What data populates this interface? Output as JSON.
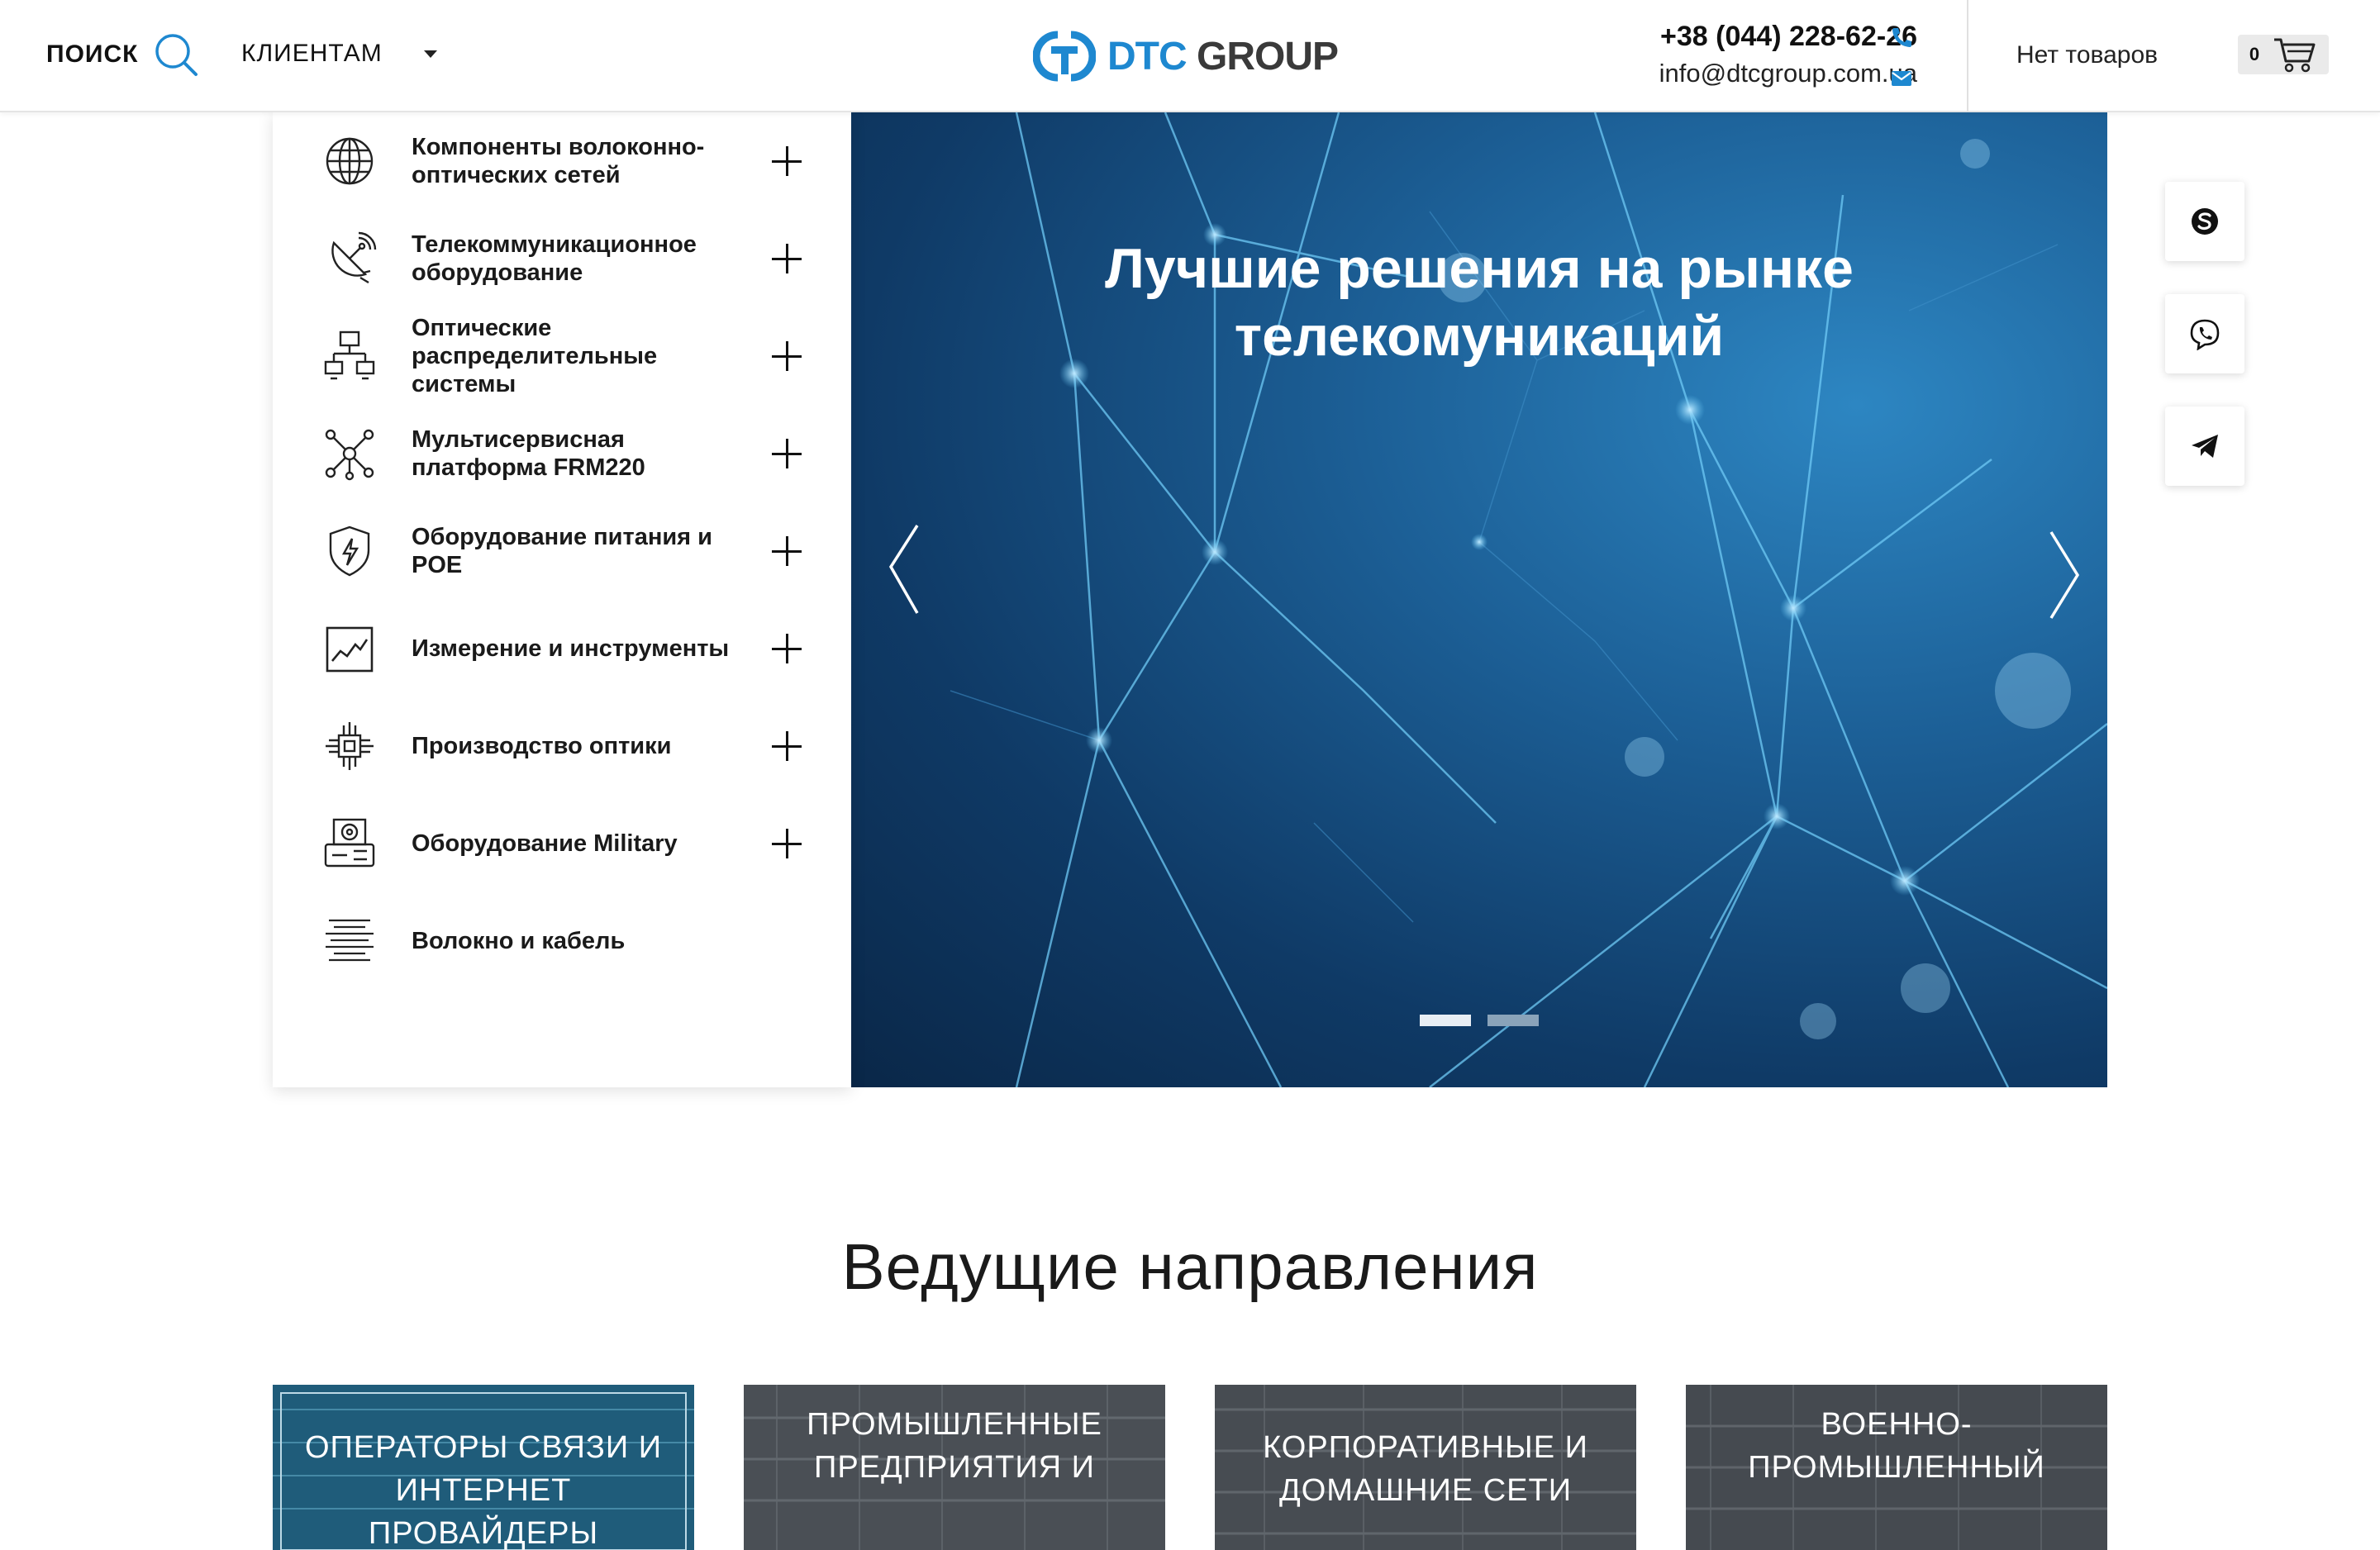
{
  "header": {
    "search_label": "ПОИСК",
    "clients_label": "КЛИЕНТАМ",
    "logo_dtc": "DTC",
    "logo_group": "GROUP",
    "phone": "+38 (044) 228-62-26",
    "email": "info@dtcgroup.com.ua",
    "cart_text": "Нет товаров",
    "cart_count": "0"
  },
  "sidebar": {
    "items": [
      {
        "label": "Компоненты волоконно-оптических сетей",
        "icon": "globe-icon"
      },
      {
        "label": "Телекоммуникационное оборудование",
        "icon": "satellite-dish-icon"
      },
      {
        "label": "Оптические распределительные системы",
        "icon": "network-monitors-icon"
      },
      {
        "label": "Мультисервисная платформа FRM220",
        "icon": "hub-nodes-icon"
      },
      {
        "label": "Оборудование питания и POE",
        "icon": "shield-bolt-icon"
      },
      {
        "label": "Измерение и инструменты",
        "icon": "chart-line-icon"
      },
      {
        "label": "Производство оптики",
        "icon": "chip-icon"
      },
      {
        "label": "Оборудование Military",
        "icon": "radio-device-icon"
      },
      {
        "label": "Волокно и кабель",
        "icon": "cable-lines-icon"
      }
    ]
  },
  "banner": {
    "title_line1": "Лучшие решения на рынке",
    "title_line2": "телекомуникаций",
    "slides_total": 2,
    "active_slide": 1
  },
  "social": [
    "skype-icon",
    "viber-icon",
    "telegram-icon"
  ],
  "directions": {
    "title": "Ведущие направления",
    "cards": [
      {
        "line1": "ОПЕРАТОРЫ СВЯЗИ И",
        "line2": "ИНТЕРНЕТ ПРОВАЙДЕРЫ"
      },
      {
        "line1": "ПРОМЫШЛЕННЫЕ",
        "line2": "ПРЕДПРИЯТИЯ И"
      },
      {
        "line1": "КОРПОРАТИВНЫЕ И",
        "line2": "ДОМАШНИЕ СЕТИ"
      },
      {
        "line1": "ВОЕННО-",
        "line2": "ПРОМЫШЛЕННЫЙ"
      }
    ]
  },
  "colors": {
    "brand_blue": "#1e88d0",
    "banner_dark": "#0f3a66",
    "banner_light": "#2d86c2"
  }
}
